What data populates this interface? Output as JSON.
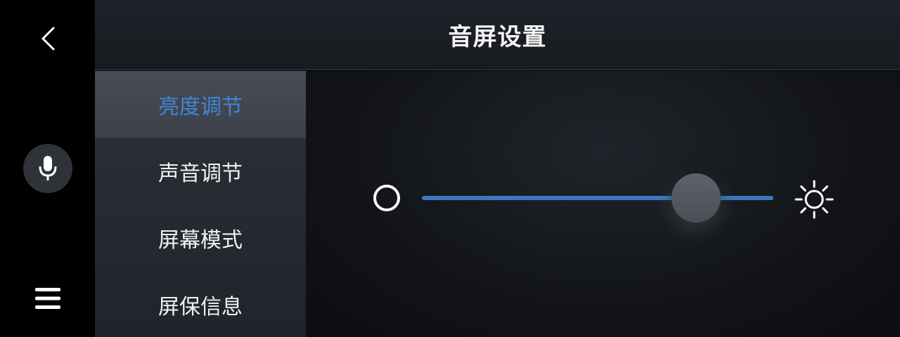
{
  "header": {
    "title": "音屏设置"
  },
  "rail": {
    "back_icon": "chevron-left-icon",
    "mic_icon": "microphone-icon",
    "menu_icon": "hamburger-menu-icon"
  },
  "sidenav": {
    "items": [
      {
        "label": "亮度调节",
        "active": true
      },
      {
        "label": "声音调节",
        "active": false
      },
      {
        "label": "屏幕模式",
        "active": false
      },
      {
        "label": "屏保信息",
        "active": false
      }
    ]
  },
  "brightness": {
    "value": 0.78,
    "min_icon": "dim-circle-icon",
    "max_icon": "sun-icon",
    "track_color": "#3a78c0"
  },
  "colors": {
    "accent": "#3f86d6",
    "background": "#000000"
  }
}
